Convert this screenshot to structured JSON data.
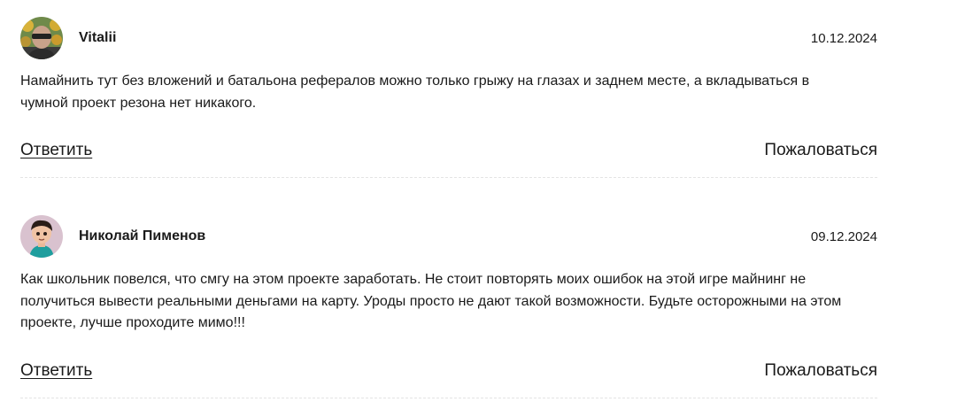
{
  "comments": [
    {
      "author": "Vitalii",
      "date": "10.12.2024",
      "avatar_icon": "user-photo-avatar",
      "text": "Намайнить тут без вложений и батальона рефералов можно только грыжу на глазах и заднем месте, а вкладываться в чумной проект резона нет никакого.",
      "reply_label": "Ответить",
      "report_label": "Пожаловаться"
    },
    {
      "author": "Николай Пименов",
      "date": "09.12.2024",
      "avatar_icon": "cartoon-character-avatar",
      "text": "Как школьник повелся, что смгу на этом проекте заработать. Не стоит повторять моих ошибок на этой игре майнинг не получиться вывести реальными деньгами на карту. Уроды просто не дают такой возможности. Будьте осторожными на этом проекте, лучше проходите мимо!!!",
      "reply_label": "Ответить",
      "report_label": "Пожаловаться"
    }
  ],
  "colors": {
    "text": "#1a1a1a",
    "divider": "#e4e4e4",
    "background": "#ffffff"
  }
}
